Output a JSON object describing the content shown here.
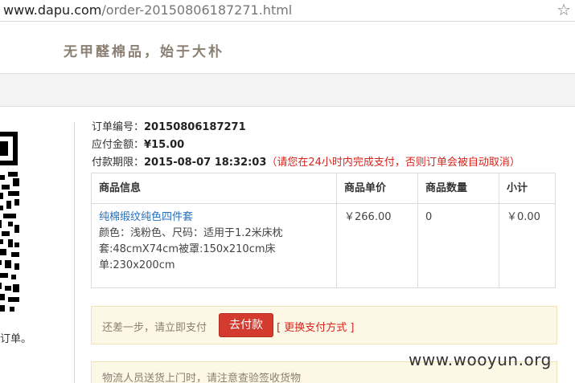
{
  "browser": {
    "url_domain": "www.dapu.com",
    "url_path": "/order-20150806187271.html",
    "bookmark_icon": "star-icon"
  },
  "header": {
    "slogan": "无甲醛棉品，始于大朴"
  },
  "qr": {
    "caption": "订单。"
  },
  "order": {
    "number_label": "订单编号：",
    "number": "20150806187271",
    "amount_label": "应付金额：",
    "amount": "¥15.00",
    "deadline_label": "付款期限：",
    "deadline": "2015-08-07 18:32:03",
    "deadline_warning": "（请您在24小时内完成支付，否则订单会被自动取消）"
  },
  "table": {
    "headers": [
      "商品信息",
      "商品单价",
      "商品数量",
      "小计"
    ],
    "rows": [
      {
        "name": "纯棉缎纹纯色四件套",
        "desc": "颜色：浅粉色、尺码：适用于1.2米床枕套:48cmX74cm被罩:150x210cm床单:230x200cm",
        "price": "￥266.00",
        "qty": "0",
        "subtotal": "￥0.00"
      }
    ]
  },
  "payment": {
    "message": "还差一步，请立即支付",
    "pay_button": "去付款",
    "change_method": "[ 更换支付方式 ]"
  },
  "logistics": {
    "message": "物流人员送货上门时，请注意查验签收货物"
  },
  "watermark": "www.wooyun.org"
}
